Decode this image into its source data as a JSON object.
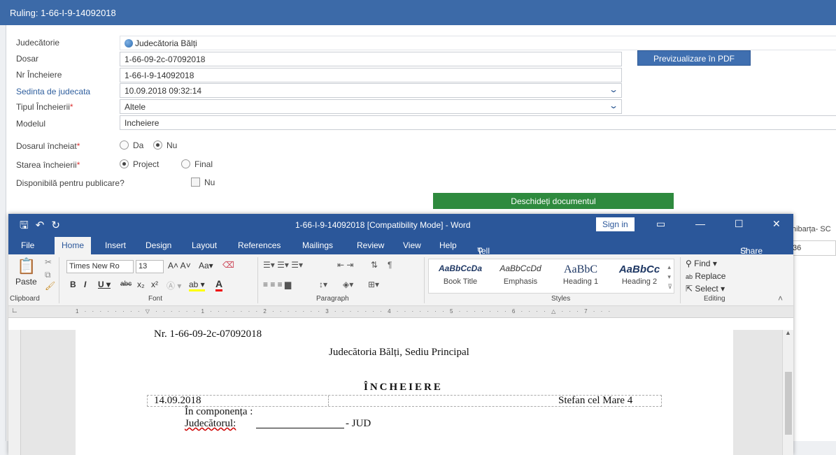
{
  "window_title": "Ruling: 1-66-I-9-14092018",
  "form": {
    "court_label": "Judecătorie",
    "court_value": "Judecătoria Bălți",
    "dosar_label": "Dosar",
    "dosar_value": "1-66-09-2c-07092018",
    "nr_label": "Nr Încheiere",
    "nr_value": "1-66-I-9-14092018",
    "sedinta_label": "Sedinta de judecata",
    "sedinta_value": "10.09.2018 09:32:14",
    "tipul_label": "Tipul Încheierii",
    "tipul_value": "Altele",
    "modelul_label": "Modelul",
    "modelul_value": "Incheiere",
    "dosar_incheiat_label": "Dosarul încheiat",
    "dosar_incheiat_da": "Da",
    "dosar_incheiat_nu": "Nu",
    "starea_label": "Starea încheierii",
    "starea_project": "Project",
    "starea_final": "Final",
    "disponibila_label": "Disponibilă pentru publicare?",
    "disponibila_nu": "Nu",
    "required_mark": "*"
  },
  "buttons": {
    "preview_pdf": "Previzualizare în PDF",
    "open_document": "Deschideți documentul"
  },
  "background_right": {
    "text1": "hibarța- SC",
    "text2": "36"
  },
  "word": {
    "doc_title": "1-66-I-9-14092018 [Compatibility Mode]  -  Word",
    "sign_in": "Sign in",
    "tabs": [
      "File",
      "Home",
      "Insert",
      "Design",
      "Layout",
      "References",
      "Mailings",
      "Review",
      "View",
      "Help"
    ],
    "tell_me": "Tell me what you want to do",
    "share": "Share",
    "font_name": "Times New Ro",
    "font_size": "13",
    "paste": "Paste",
    "groups": {
      "clipboard": "Clipboard",
      "font": "Font",
      "paragraph": "Paragraph",
      "styles": "Styles",
      "editing": "Editing"
    },
    "styles": [
      {
        "preview": "AaBbCcDa",
        "name": "Book Title"
      },
      {
        "preview": "AaBbCcDd",
        "name": "Emphasis"
      },
      {
        "preview": "AaBbC",
        "name": "Heading 1"
      },
      {
        "preview": "AaBbCc",
        "name": "Heading 2"
      }
    ],
    "editing": {
      "find": "Find",
      "replace": "Replace",
      "select": "Select"
    },
    "document": {
      "line1": "Nr. 1-66-09-2c-07092018",
      "line2": "Judecătoria Bălți, Sediu Principal",
      "heading": "ÎNCHEIERE",
      "date": "14.09.2018",
      "address": "Stefan cel Mare 4",
      "componenta": "În componența :",
      "judecatorul": "Judecătorul:",
      "jud": "- JUD"
    }
  }
}
